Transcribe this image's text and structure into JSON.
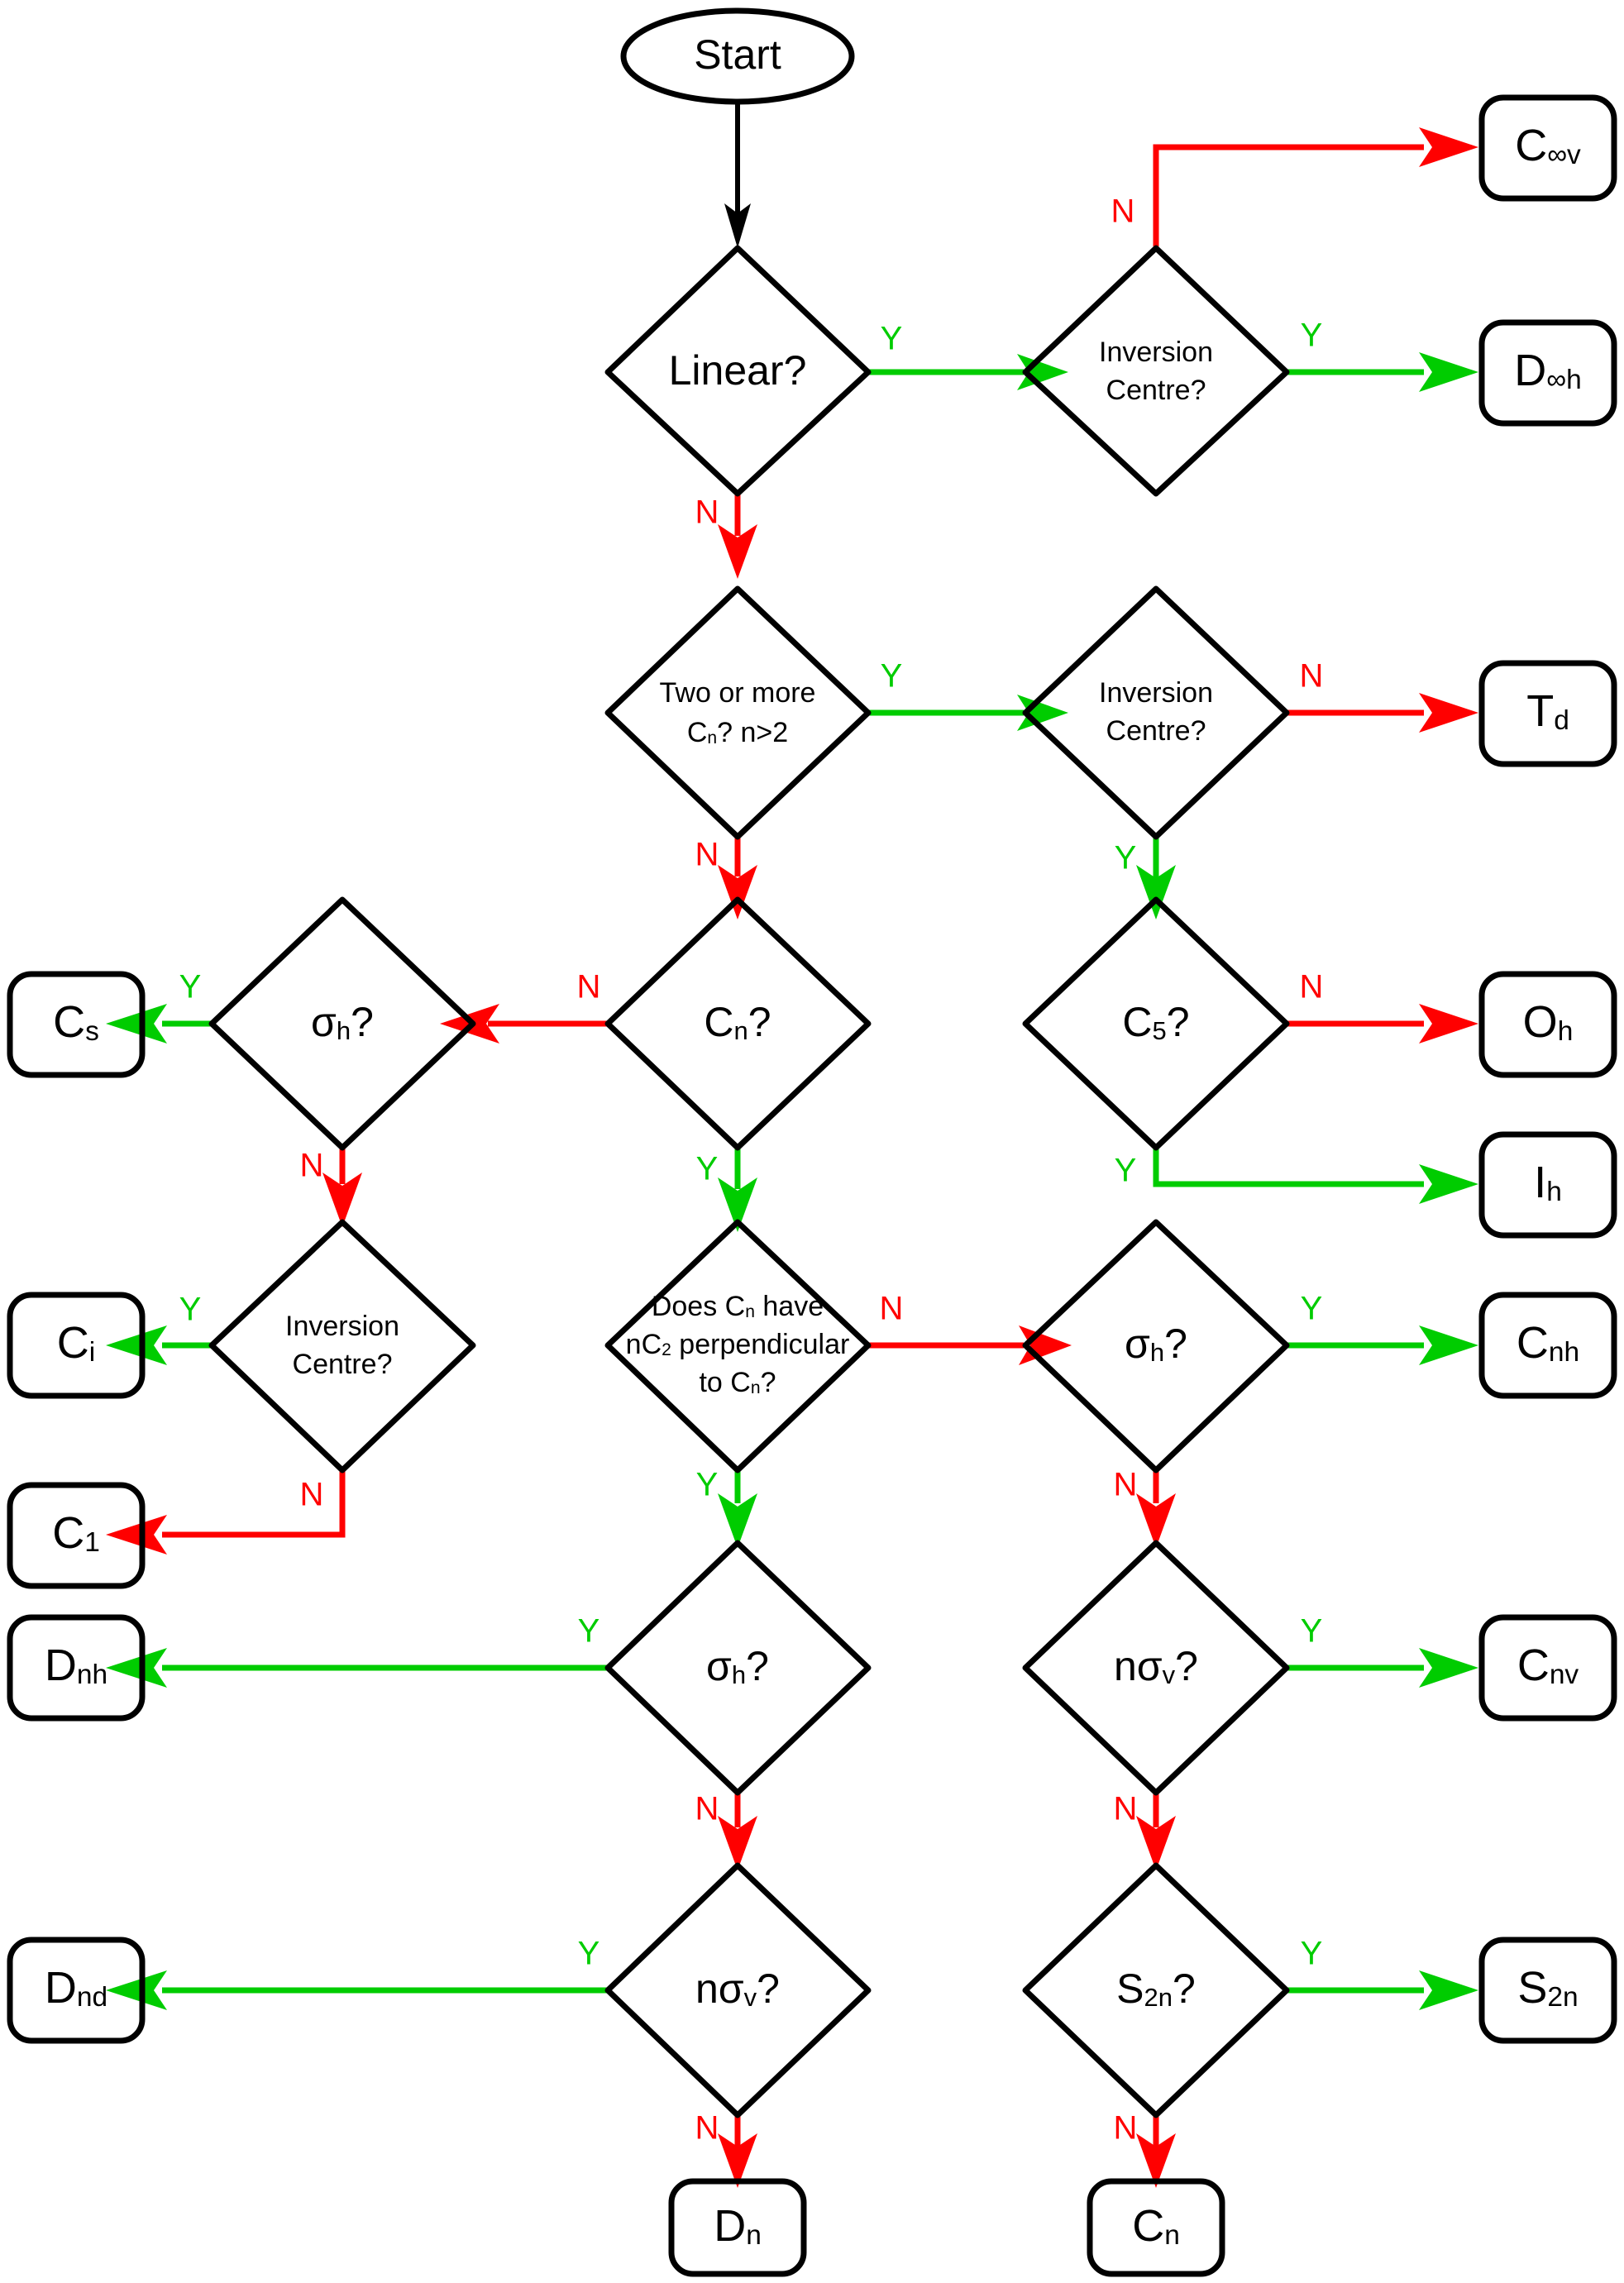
{
  "diagram": {
    "title": "Molecular Point Group Determination Flowchart",
    "colors": {
      "shape_stroke": "#000000",
      "yes_edge": "#00cc00",
      "no_edge": "#ff0000",
      "text": "#000000",
      "background": "#ffffff"
    },
    "edge_labels": {
      "yes": "Y",
      "no": "N"
    }
  },
  "start": {
    "label": "Start"
  },
  "decisions": {
    "linear": {
      "label": "Linear?"
    },
    "inv_linear": {
      "line1": "Inversion",
      "line2": "Centre?"
    },
    "two_or_more_cn": {
      "line1": "Two or more",
      "line2_pre": "C",
      "line2_sub": "n",
      "line2_post": "? n>2"
    },
    "inv_high": {
      "line1": "Inversion",
      "line2": "Centre?"
    },
    "c5": {
      "pre": "C",
      "sub": "5",
      "post": "?"
    },
    "cn": {
      "pre": "C",
      "sub": "n",
      "post": "?"
    },
    "sigma_h_left": {
      "pre": "σ",
      "sub": "h",
      "post": "?"
    },
    "inv_left": {
      "line1": "Inversion",
      "line2": "Centre?"
    },
    "nc2_perp": {
      "line1_pre": "Does C",
      "line1_sub": "n",
      "line1_post": " have",
      "line2_pre": "nC",
      "line2_sub": "2",
      "line2_post": " perpendicular",
      "line3_pre": "to C",
      "line3_sub": "n",
      "line3_post": "?"
    },
    "sigma_h_right": {
      "pre": "σ",
      "sub": "h",
      "post": "?"
    },
    "sigma_h_mid": {
      "pre": "σ",
      "sub": "h",
      "post": "?"
    },
    "nsigma_v_right": {
      "pre": "nσ",
      "sub": "v",
      "post": "?"
    },
    "nsigma_v_mid": {
      "pre": "nσ",
      "sub": "v",
      "post": "?"
    },
    "s2n": {
      "pre": "S",
      "sub": "2n",
      "post": "?"
    }
  },
  "terminals": {
    "c_inf_v": {
      "pre": "C",
      "sub": "∞v"
    },
    "d_inf_h": {
      "pre": "D",
      "sub": "∞h"
    },
    "t_d": {
      "pre": "T",
      "sub": "d"
    },
    "o_h": {
      "pre": "O",
      "sub": "h"
    },
    "i_h": {
      "pre": "I",
      "sub": "h"
    },
    "c_s": {
      "pre": "C",
      "sub": "s"
    },
    "c_i": {
      "pre": "C",
      "sub": "i"
    },
    "c_1": {
      "pre": "C",
      "sub": "1"
    },
    "c_nh": {
      "pre": "C",
      "sub": "nh"
    },
    "c_nv": {
      "pre": "C",
      "sub": "nv"
    },
    "d_nh": {
      "pre": "D",
      "sub": "nh"
    },
    "d_nd": {
      "pre": "D",
      "sub": "nd"
    },
    "s_2n": {
      "pre": "S",
      "sub": "2n"
    },
    "d_n": {
      "pre": "D",
      "sub": "n"
    },
    "c_n": {
      "pre": "C",
      "sub": "n"
    }
  },
  "labels": {
    "linear_yes": "Y",
    "linear_no": "N",
    "inv_linear_yes": "Y",
    "inv_linear_no": "N",
    "two_cn_yes": "Y",
    "two_cn_no": "N",
    "inv_high_yes": "Y",
    "inv_high_no": "N",
    "c5_yes": "Y",
    "c5_no": "N",
    "cn_yes": "Y",
    "cn_no": "N",
    "sigma_h_left_yes": "Y",
    "sigma_h_left_no": "N",
    "inv_left_yes": "Y",
    "inv_left_no": "N",
    "nc2_yes": "Y",
    "nc2_no": "N",
    "sigma_h_right_yes": "Y",
    "sigma_h_right_no": "N",
    "sigma_h_mid_yes": "Y",
    "sigma_h_mid_no": "N",
    "nsv_right_yes": "Y",
    "nsv_right_no": "N",
    "nsv_mid_yes": "Y",
    "nsv_mid_no": "N",
    "s2n_yes": "Y",
    "s2n_no": "N"
  }
}
